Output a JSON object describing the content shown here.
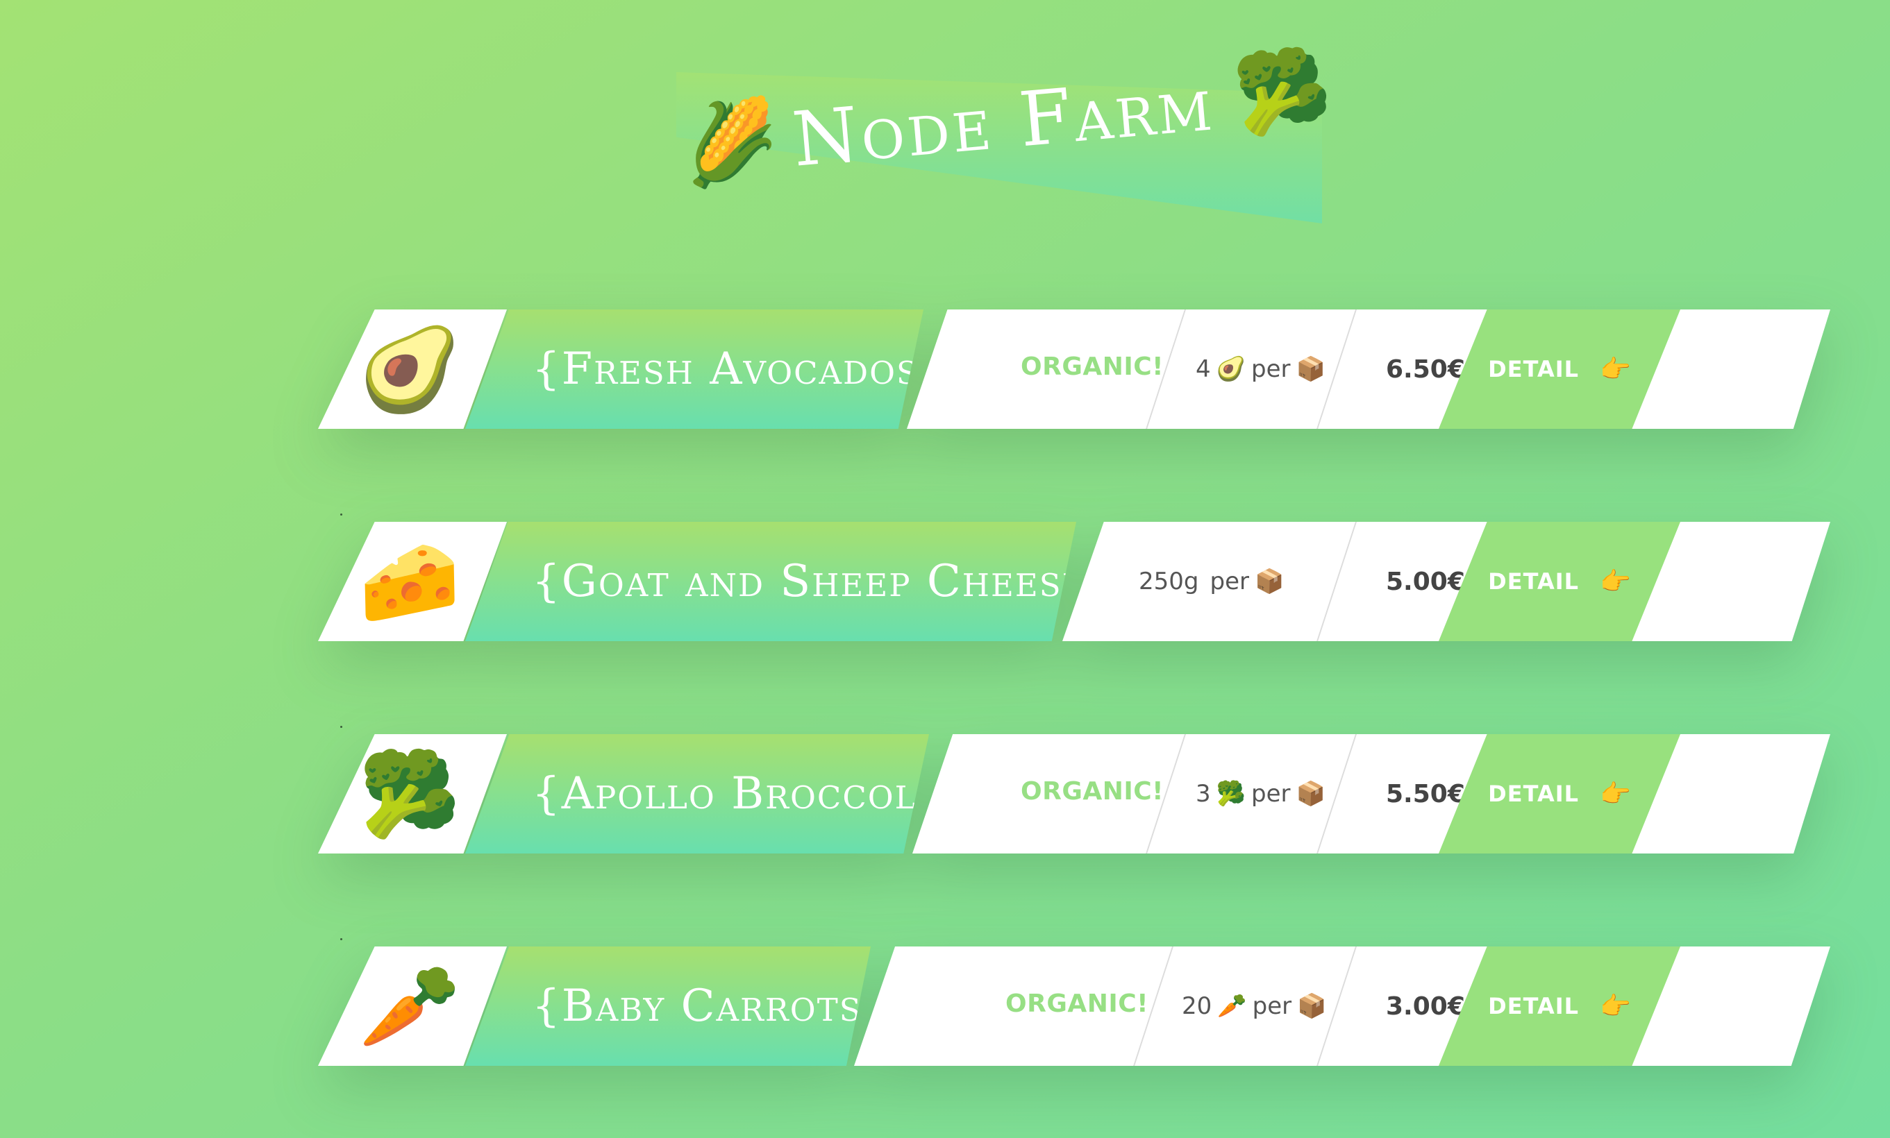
{
  "header": {
    "title": "Node Farm",
    "emoji_left": "🌽",
    "emoji_right": "🥦",
    "emoji_left_name": "corn-icon",
    "emoji_right_name": "broccoli-icon"
  },
  "colors": {
    "background_start": "#a3e274",
    "background_end": "#74de9e",
    "organic_text": "#97df84",
    "detail_button": "#98e17e",
    "price_text": "#444444"
  },
  "products": [
    {
      "emoji": "🥑",
      "emoji_name": "avocado-icon",
      "name": "{Fresh Avocados}",
      "organic_label": "ORGANIC!",
      "quantity": "4",
      "quantity_emoji": "🥑",
      "per_label": "per",
      "box_emoji": "📦",
      "price": "6.50€",
      "detail_label": "DETAIL",
      "pointer_emoji": "👉"
    },
    {
      "emoji": "🧀",
      "emoji_name": "cheese-icon",
      "name": "{Goat and Sheep Cheese}",
      "organic_label": "",
      "quantity": "250g",
      "quantity_emoji": "",
      "per_label": "per",
      "box_emoji": "📦",
      "price": "5.00€",
      "detail_label": "DETAIL",
      "pointer_emoji": "👉"
    },
    {
      "emoji": "🥦",
      "emoji_name": "broccoli-icon",
      "name": "{Apollo Broccoli}",
      "organic_label": "ORGANIC!",
      "quantity": "3",
      "quantity_emoji": "🥦",
      "per_label": "per",
      "box_emoji": "📦",
      "price": "5.50€",
      "detail_label": "DETAIL",
      "pointer_emoji": "👉"
    },
    {
      "emoji": "🥕",
      "emoji_name": "carrot-icon",
      "name": "{Baby Carrots}",
      "organic_label": "ORGANIC!",
      "quantity": "20",
      "quantity_emoji": "🥕",
      "per_label": "per",
      "box_emoji": "📦",
      "price": "3.00€",
      "detail_label": "DETAIL",
      "pointer_emoji": "👉"
    }
  ]
}
